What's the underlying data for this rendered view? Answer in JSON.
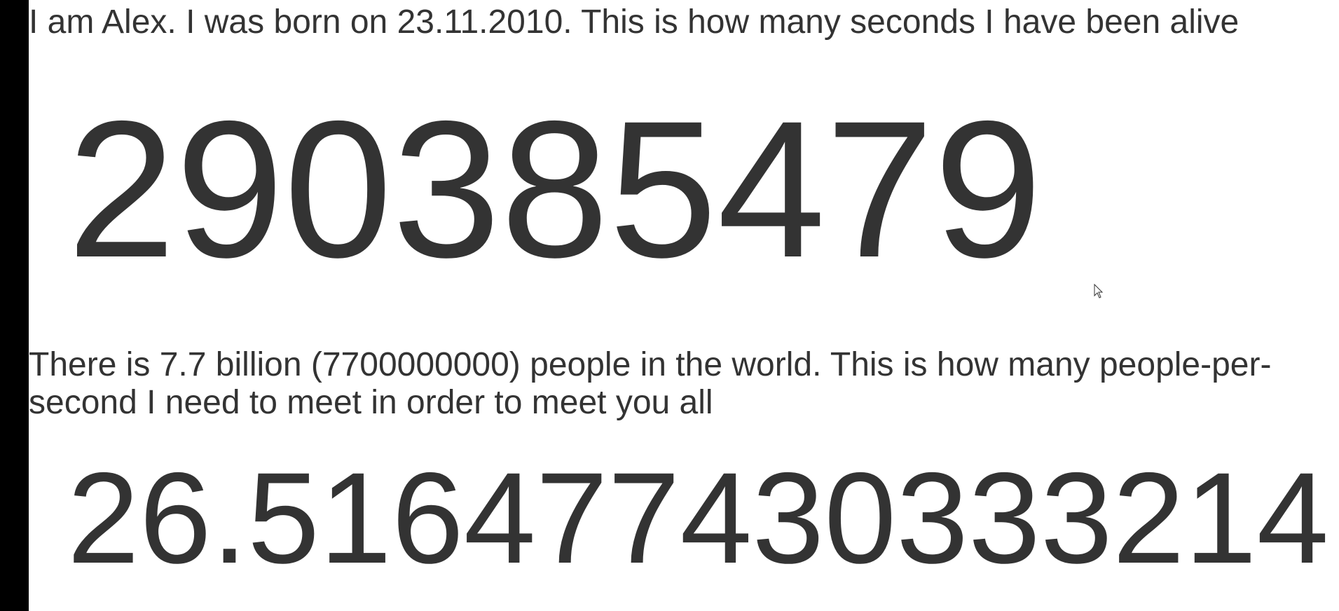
{
  "intro_text": "I am Alex. I was born on 23.11.2010. This is how many seconds I have been alive",
  "seconds_alive": "290385479",
  "people_text": "There is 7.7 billion (7700000000) people in the world. This is how many people-per-second I need to meet in order to meet you all",
  "people_per_second": "26.516477430333214",
  "colors": {
    "text": "#333333",
    "background": "#ffffff",
    "left_bar": "#000000"
  },
  "icons": {
    "cursor": "mouse-pointer-icon"
  }
}
